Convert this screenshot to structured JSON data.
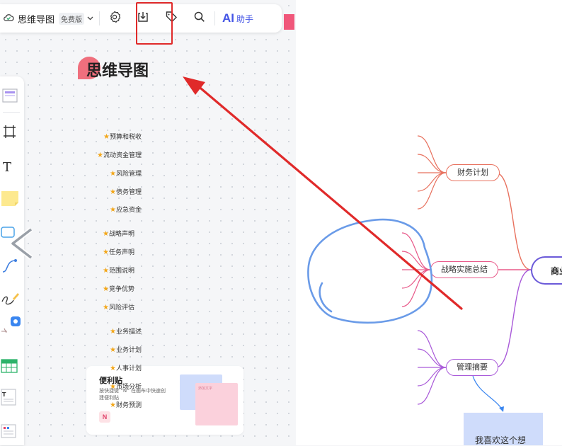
{
  "toolbar": {
    "doc_title": "思维导图",
    "plan_badge": "免费版",
    "ai_label": "AI",
    "ai_suffix": "助手"
  },
  "canvas": {
    "heading": "思维导图"
  },
  "sticky_card": {
    "title": "便利贴",
    "description": "按快捷键 “N” 在画布中快速创建便利贴",
    "shortcut_key": "N",
    "preview_text": "添加文字"
  },
  "mindmap": {
    "root_label": "商业",
    "branches": [
      {
        "label": "财务计划",
        "color": "#e8715e",
        "items": [
          "预算和税收",
          "流动资金管理",
          "风险管理",
          "债务管理",
          "应急资金"
        ]
      },
      {
        "label": "战略实施总结",
        "color": "#e85a8a",
        "items": [
          "战略声明",
          "任务声明",
          "范围说明",
          "竞争优势",
          "风险评估"
        ]
      },
      {
        "label": "管理摘要",
        "color": "#a95ad9",
        "items": [
          "业务描述",
          "业务计划",
          "人事计划",
          "市场分析",
          "财务预测"
        ]
      }
    ],
    "note_text": "我喜欢这个想"
  },
  "colors": {
    "accent": "#4455e6",
    "highlight": "#e02a2a",
    "annotation_circle": "#6a9be8",
    "star": "#f3a71a"
  }
}
